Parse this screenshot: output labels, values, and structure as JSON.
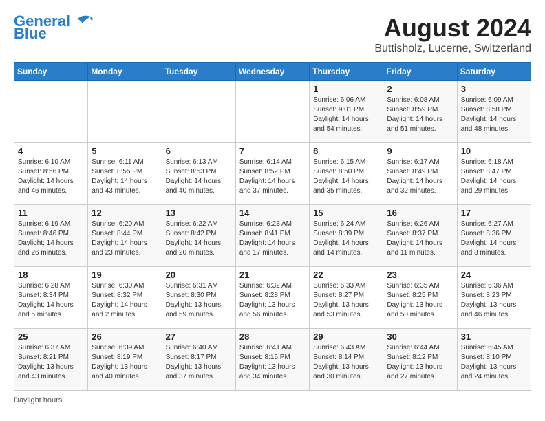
{
  "logo": {
    "line1": "General",
    "line2": "Blue"
  },
  "title": "August 2024",
  "subtitle": "Buttisholz, Lucerne, Switzerland",
  "days_of_week": [
    "Sunday",
    "Monday",
    "Tuesday",
    "Wednesday",
    "Thursday",
    "Friday",
    "Saturday"
  ],
  "weeks": [
    {
      "days": [
        {
          "num": "",
          "info": ""
        },
        {
          "num": "",
          "info": ""
        },
        {
          "num": "",
          "info": ""
        },
        {
          "num": "",
          "info": ""
        },
        {
          "num": "1",
          "info": "Sunrise: 6:06 AM\nSunset: 9:01 PM\nDaylight: 14 hours\nand 54 minutes."
        },
        {
          "num": "2",
          "info": "Sunrise: 6:08 AM\nSunset: 8:59 PM\nDaylight: 14 hours\nand 51 minutes."
        },
        {
          "num": "3",
          "info": "Sunrise: 6:09 AM\nSunset: 8:58 PM\nDaylight: 14 hours\nand 48 minutes."
        }
      ]
    },
    {
      "days": [
        {
          "num": "4",
          "info": "Sunrise: 6:10 AM\nSunset: 8:56 PM\nDaylight: 14 hours\nand 46 minutes."
        },
        {
          "num": "5",
          "info": "Sunrise: 6:11 AM\nSunset: 8:55 PM\nDaylight: 14 hours\nand 43 minutes."
        },
        {
          "num": "6",
          "info": "Sunrise: 6:13 AM\nSunset: 8:53 PM\nDaylight: 14 hours\nand 40 minutes."
        },
        {
          "num": "7",
          "info": "Sunrise: 6:14 AM\nSunset: 8:52 PM\nDaylight: 14 hours\nand 37 minutes."
        },
        {
          "num": "8",
          "info": "Sunrise: 6:15 AM\nSunset: 8:50 PM\nDaylight: 14 hours\nand 35 minutes."
        },
        {
          "num": "9",
          "info": "Sunrise: 6:17 AM\nSunset: 8:49 PM\nDaylight: 14 hours\nand 32 minutes."
        },
        {
          "num": "10",
          "info": "Sunrise: 6:18 AM\nSunset: 8:47 PM\nDaylight: 14 hours\nand 29 minutes."
        }
      ]
    },
    {
      "days": [
        {
          "num": "11",
          "info": "Sunrise: 6:19 AM\nSunset: 8:46 PM\nDaylight: 14 hours\nand 26 minutes."
        },
        {
          "num": "12",
          "info": "Sunrise: 6:20 AM\nSunset: 8:44 PM\nDaylight: 14 hours\nand 23 minutes."
        },
        {
          "num": "13",
          "info": "Sunrise: 6:22 AM\nSunset: 8:42 PM\nDaylight: 14 hours\nand 20 minutes."
        },
        {
          "num": "14",
          "info": "Sunrise: 6:23 AM\nSunset: 8:41 PM\nDaylight: 14 hours\nand 17 minutes."
        },
        {
          "num": "15",
          "info": "Sunrise: 6:24 AM\nSunset: 8:39 PM\nDaylight: 14 hours\nand 14 minutes."
        },
        {
          "num": "16",
          "info": "Sunrise: 6:26 AM\nSunset: 8:37 PM\nDaylight: 14 hours\nand 11 minutes."
        },
        {
          "num": "17",
          "info": "Sunrise: 6:27 AM\nSunset: 8:36 PM\nDaylight: 14 hours\nand 8 minutes."
        }
      ]
    },
    {
      "days": [
        {
          "num": "18",
          "info": "Sunrise: 6:28 AM\nSunset: 8:34 PM\nDaylight: 14 hours\nand 5 minutes."
        },
        {
          "num": "19",
          "info": "Sunrise: 6:30 AM\nSunset: 8:32 PM\nDaylight: 14 hours\nand 2 minutes."
        },
        {
          "num": "20",
          "info": "Sunrise: 6:31 AM\nSunset: 8:30 PM\nDaylight: 13 hours\nand 59 minutes."
        },
        {
          "num": "21",
          "info": "Sunrise: 6:32 AM\nSunset: 8:28 PM\nDaylight: 13 hours\nand 56 minutes."
        },
        {
          "num": "22",
          "info": "Sunrise: 6:33 AM\nSunset: 8:27 PM\nDaylight: 13 hours\nand 53 minutes."
        },
        {
          "num": "23",
          "info": "Sunrise: 6:35 AM\nSunset: 8:25 PM\nDaylight: 13 hours\nand 50 minutes."
        },
        {
          "num": "24",
          "info": "Sunrise: 6:36 AM\nSunset: 8:23 PM\nDaylight: 13 hours\nand 46 minutes."
        }
      ]
    },
    {
      "days": [
        {
          "num": "25",
          "info": "Sunrise: 6:37 AM\nSunset: 8:21 PM\nDaylight: 13 hours\nand 43 minutes."
        },
        {
          "num": "26",
          "info": "Sunrise: 6:39 AM\nSunset: 8:19 PM\nDaylight: 13 hours\nand 40 minutes."
        },
        {
          "num": "27",
          "info": "Sunrise: 6:40 AM\nSunset: 8:17 PM\nDaylight: 13 hours\nand 37 minutes."
        },
        {
          "num": "28",
          "info": "Sunrise: 6:41 AM\nSunset: 8:15 PM\nDaylight: 13 hours\nand 34 minutes."
        },
        {
          "num": "29",
          "info": "Sunrise: 6:43 AM\nSunset: 8:14 PM\nDaylight: 13 hours\nand 30 minutes."
        },
        {
          "num": "30",
          "info": "Sunrise: 6:44 AM\nSunset: 8:12 PM\nDaylight: 13 hours\nand 27 minutes."
        },
        {
          "num": "31",
          "info": "Sunrise: 6:45 AM\nSunset: 8:10 PM\nDaylight: 13 hours\nand 24 minutes."
        }
      ]
    }
  ],
  "footer": "Daylight hours"
}
